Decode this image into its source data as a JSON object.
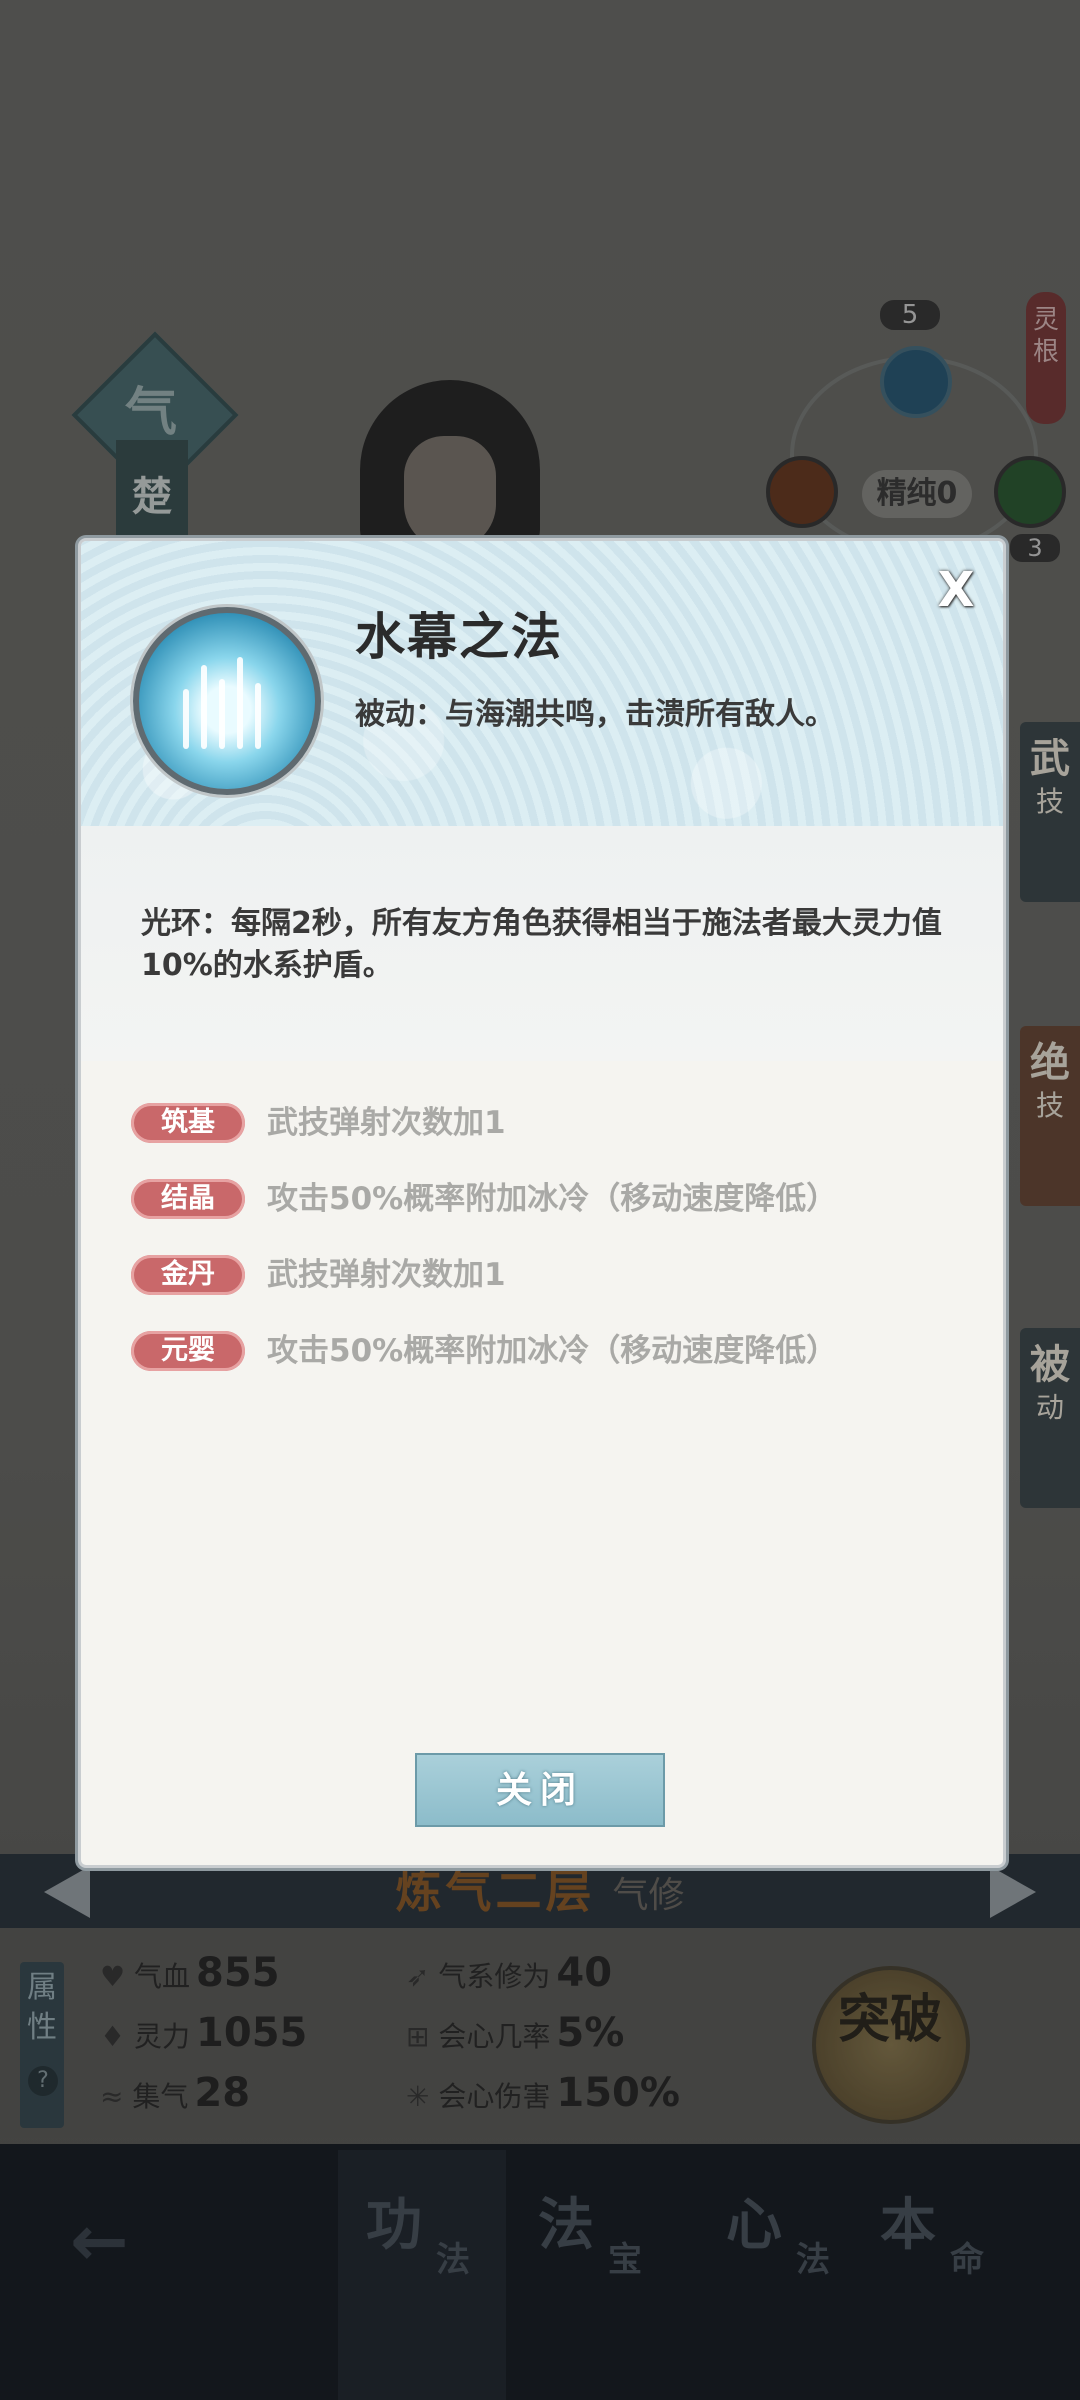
{
  "background": {
    "character_name": "楚",
    "qi_label": "气",
    "spirit_root": {
      "label": "灵根",
      "purity": "精纯0",
      "count_top": "5",
      "count_bottom": "3"
    },
    "side_tabs": [
      {
        "big": "武",
        "small": "技"
      },
      {
        "big": "绝",
        "small": "技"
      },
      {
        "big": "被",
        "small": "动"
      }
    ],
    "realm": {
      "name": "炼气二层",
      "type": "气修"
    },
    "stats_label": "属性",
    "stats": [
      {
        "icon": "heart-icon",
        "label": "气血",
        "value": "855"
      },
      {
        "icon": "drop-icon",
        "label": "灵力",
        "value": "1055"
      },
      {
        "icon": "swirl-icon",
        "label": "集气",
        "value": "28"
      },
      {
        "icon": "wind-icon",
        "label": "气系修为",
        "value": "40"
      },
      {
        "icon": "crit-icon",
        "label": "会心几率",
        "value": "5%"
      },
      {
        "icon": "star-burst-icon",
        "label": "会心伤害",
        "value": "150%"
      }
    ],
    "breakthrough_label": "突破",
    "nav": [
      {
        "big": "功",
        "small": "法"
      },
      {
        "big": "法",
        "small": "宝"
      },
      {
        "big": "心",
        "small": "法"
      },
      {
        "big": "本",
        "small": "命"
      }
    ]
  },
  "dialog": {
    "title": "水幕之法",
    "passive": "被动：与海潮共鸣，击溃所有敌人。",
    "aura": "光环：每隔2秒，所有友方角色获得相当于施法者最大灵力值10%的水系护盾。",
    "stages": [
      {
        "label": "筑基",
        "desc": "武技弹射次数加1"
      },
      {
        "label": "结晶",
        "desc": "攻击50%概率附加冰冷（移动速度降低）"
      },
      {
        "label": "金丹",
        "desc": "武技弹射次数加1"
      },
      {
        "label": "元婴",
        "desc": "攻击50%概率附加冰冷（移动速度降低）"
      }
    ],
    "close_label": "关闭",
    "close_x": "X"
  },
  "colors": {
    "badge": "#c9686a",
    "button": "#9cc7d3",
    "header_wave": "#d6eaf0"
  }
}
